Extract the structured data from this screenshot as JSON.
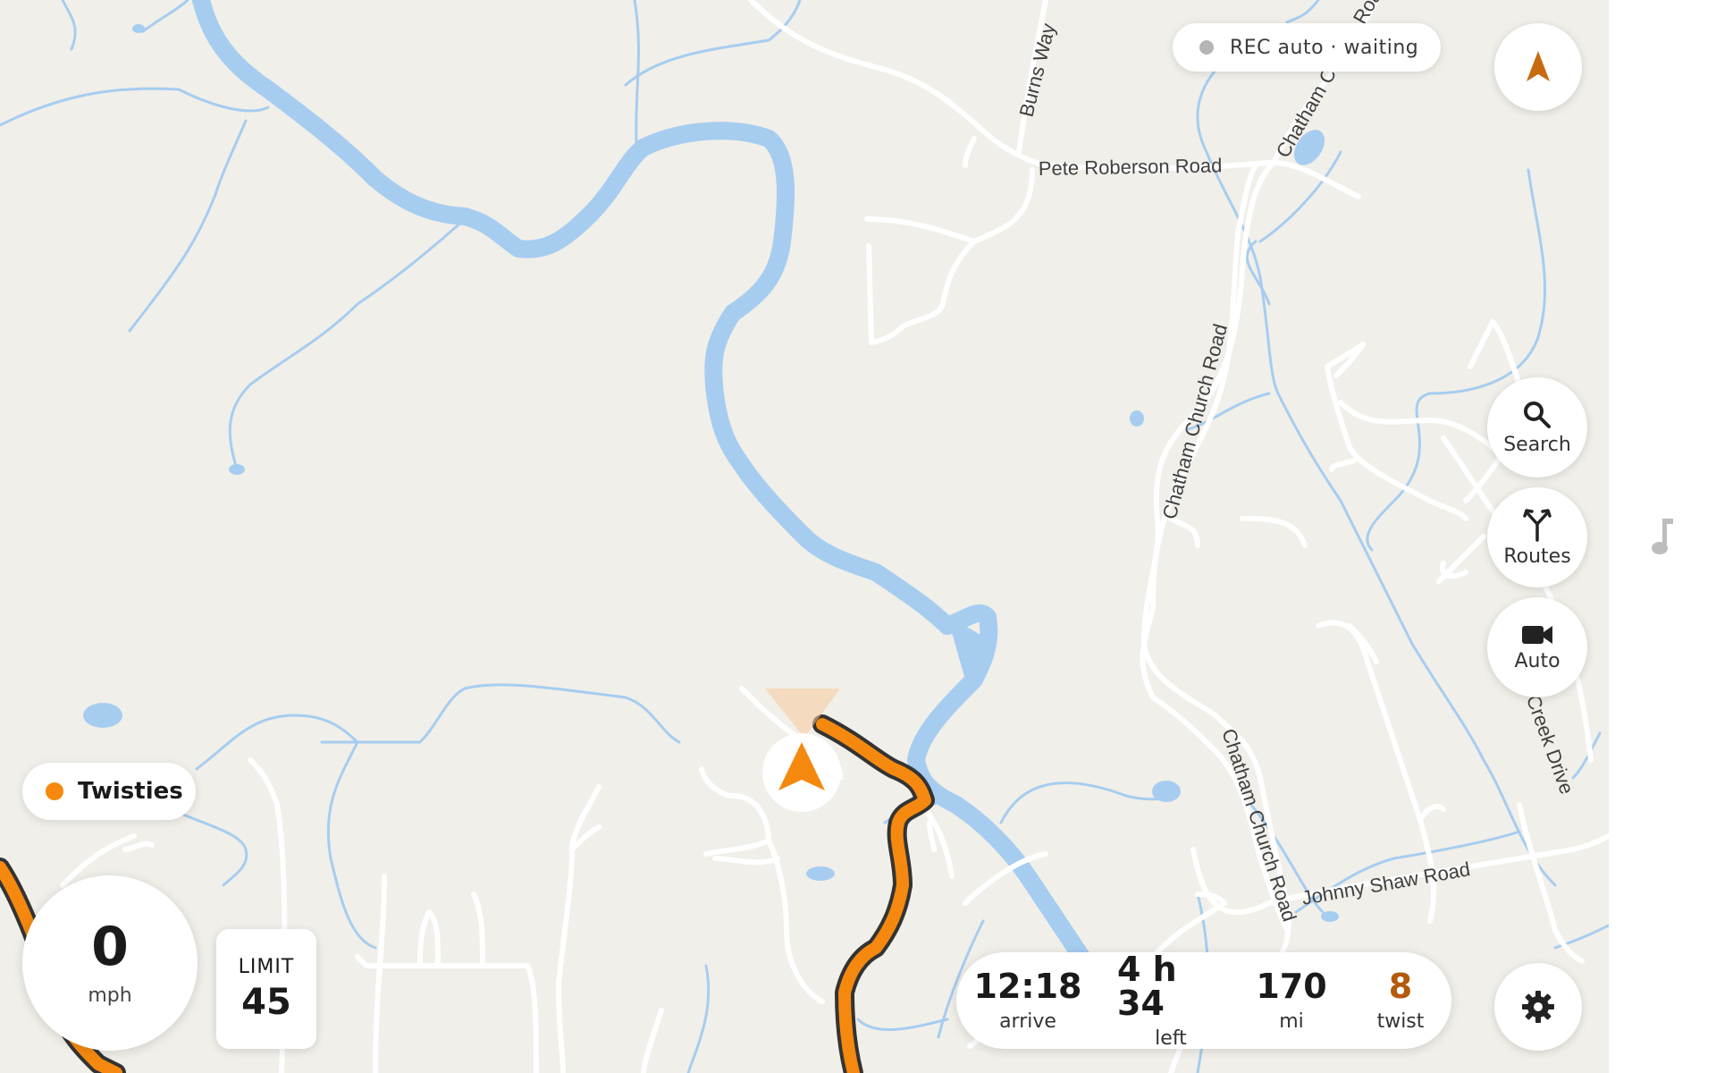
{
  "status": {
    "rec_label": "REC auto · waiting",
    "rec_dot_color": "#b5b5b5"
  },
  "controls": {
    "compass_icon": "north-arrow-icon",
    "search_label": "Search",
    "routes_label": "Routes",
    "camera_label": "Auto",
    "settings_icon": "gear-icon",
    "music_icon": "music-note-icon"
  },
  "layer": {
    "label": "Twisties",
    "dot_color": "#f5890f"
  },
  "speed": {
    "value": "0",
    "unit": "mph"
  },
  "limit": {
    "label": "LIMIT",
    "value": "45"
  },
  "trip": {
    "arrive_value": "12:18",
    "arrive_label": "arrive",
    "left_value": "4 h 34",
    "left_label": "left",
    "distance_value": "170",
    "distance_label": "mi",
    "twist_value": "8",
    "twist_label": "twist",
    "twist_color": "#b35a0b"
  },
  "map": {
    "road_labels": {
      "burns_way": "Burns Way",
      "pete_roberson": "Pete Roberson Road",
      "chatham_church_top": "Chatham Church Road",
      "chatham_church_mid": "Chatham Church Road",
      "chatham_church_low": "Chatham Church Road",
      "johnny_shaw": "Johnny Shaw Road",
      "creek_drive": "is Creek Drive"
    },
    "colors": {
      "land": "#f1efe9",
      "water": "#a6cdf0",
      "road": "#ffffff",
      "route": "#f5890f",
      "route_casing": "#333333",
      "position": "#f5890f"
    }
  }
}
